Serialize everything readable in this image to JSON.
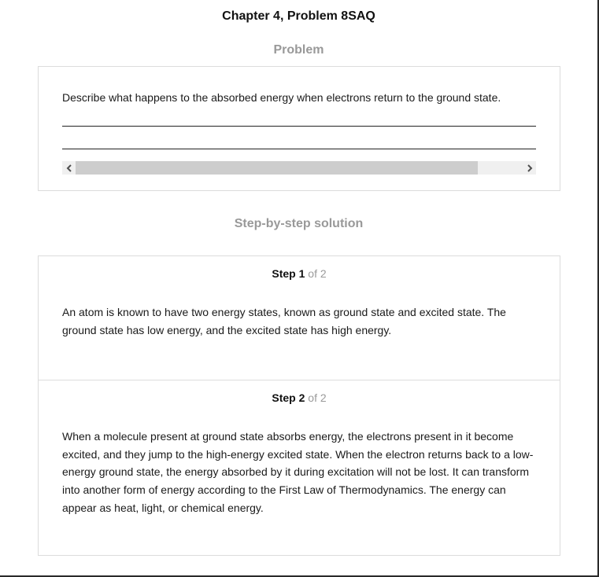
{
  "page": {
    "title": "Chapter 4, Problem 8SAQ"
  },
  "problem": {
    "heading": "Problem",
    "text": "Describe what happens to the absorbed energy when electrons return to the ground state."
  },
  "solution": {
    "heading": "Step-by-step solution",
    "step_word": "Step",
    "steps": [
      {
        "number": "1",
        "of_label": "of 2",
        "text": "An atom is known to have two energy states, known as ground state and excited state. The ground state has low energy, and the excited state has high energy."
      },
      {
        "number": "2",
        "of_label": "of 2",
        "text": "When a molecule present at ground state absorbs energy, the electrons present in it become excited, and they jump to the high-energy excited state. When the electron returns back to a low-energy ground state, the energy absorbed by it during excitation will not be lost. It can transform into another form of energy according to the First Law of Thermodynamics. The energy can appear as heat, light, or chemical energy."
      }
    ]
  },
  "icons": {
    "scroll_left": "chevron-left-icon",
    "scroll_right": "chevron-right-icon"
  }
}
